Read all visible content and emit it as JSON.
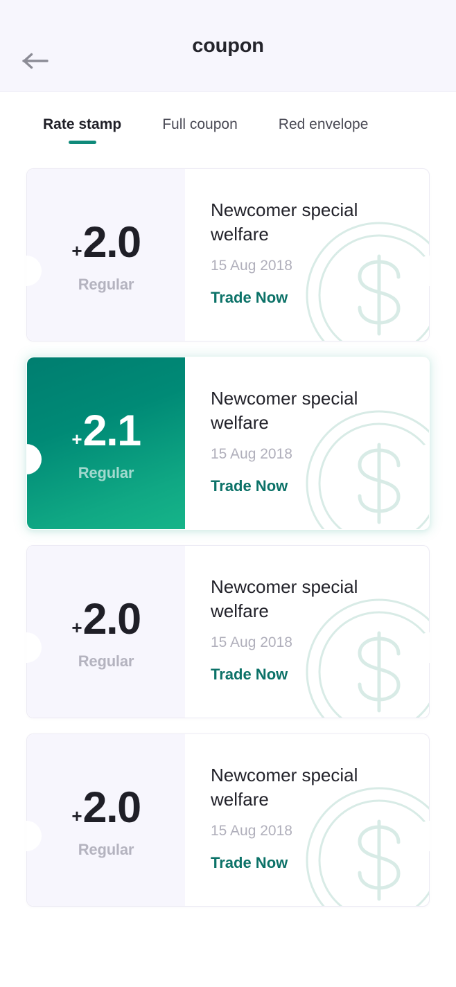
{
  "header": {
    "title": "coupon",
    "back_icon": "arrow-left-icon"
  },
  "tabs": [
    {
      "label": "Rate stamp",
      "active": true
    },
    {
      "label": "Full coupon",
      "active": false
    },
    {
      "label": "Red envelope",
      "active": false
    }
  ],
  "theme": {
    "accent": "#0c7268",
    "accent_underline": "#0f8a7a",
    "gradient_start": "#007e70",
    "gradient_end": "#16b489",
    "panel_bg": "#f7f6fd",
    "header_bg": "#f7f6fd",
    "watermark": "#d8ebe6"
  },
  "coupons": [
    {
      "plus": "+",
      "value": "2.0",
      "unit": "Regular",
      "title": "Newcomer special welfare",
      "date": "15 Aug 2018",
      "cta": "Trade Now",
      "highlighted": false,
      "watermark_icon": "dollar-coin-icon"
    },
    {
      "plus": "+",
      "value": "2.1",
      "unit": "Regular",
      "title": "Newcomer special welfare",
      "date": "15 Aug 2018",
      "cta": "Trade Now",
      "highlighted": true,
      "watermark_icon": "dollar-coin-icon"
    },
    {
      "plus": "+",
      "value": "2.0",
      "unit": "Regular",
      "title": "Newcomer special welfare",
      "date": "15 Aug 2018",
      "cta": "Trade Now",
      "highlighted": false,
      "watermark_icon": "dollar-coin-icon"
    },
    {
      "plus": "+",
      "value": "2.0",
      "unit": "Regular",
      "title": "Newcomer special welfare",
      "date": "15 Aug 2018",
      "cta": "Trade Now",
      "highlighted": false,
      "watermark_icon": "dollar-coin-icon"
    }
  ]
}
